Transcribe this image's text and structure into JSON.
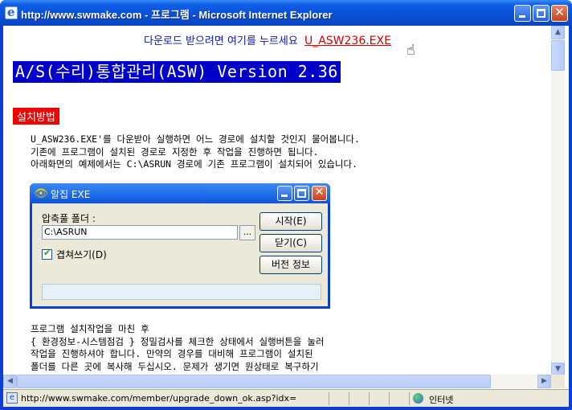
{
  "window": {
    "title": "http://www.swmake.com - 프로그램 - Microsoft Internet Explorer",
    "buttons": {
      "minimize": "minimize",
      "maximize": "maximize",
      "close": "✕"
    }
  },
  "page": {
    "download_prompt": "다운로드 받으려면 여기를 누르세요",
    "download_link": "U_ASW236.EXE",
    "app_title": "A/S(수리)통합관리(ASW) Version 2.36",
    "section_label": "설치방법",
    "paragraph1": [
      "U_ASW236.EXE'를 다운받아 실행하면 어느 경로에 설치할 것인지 물어봅니다.",
      "기존에 프로그램이 설치된 경로로 지정한 후 작업을 진행하면 됩니다.",
      "아래화면의 예제에서는 C:\\ASRUN 경로에 기존 프로그램이 설치되어 있습니다."
    ],
    "paragraph2": [
      "프로그램 설치작업을 마친 후",
      "{ 환경정보-시스템점검 } 정밀검사를 체크한 상태에서 실행버튼을 눌러",
      "작업을 진행하셔야 합니다.   만약의 경우를 대비해 프로그램이 설치된",
      "폴더를 다른 곳에 복사해 두십시오.  문제가 생기면 원상태로 복구하기"
    ]
  },
  "dialog": {
    "title": "알집 EXE",
    "folder_label": "압축풀 폴더 :",
    "folder_value": "C:\\ASRUN",
    "browse_label": "...",
    "overwrite_label": "겹쳐쓰기(D)",
    "overwrite_checked": true,
    "start_button": "시작(E)",
    "close_button": "닫기(C)",
    "version_button": "버전 정보",
    "progress": 0
  },
  "statusbar": {
    "url": "http://www.swmake.com/member/upgrade_down_ok.asp?idx=",
    "zone": "인터넷"
  }
}
